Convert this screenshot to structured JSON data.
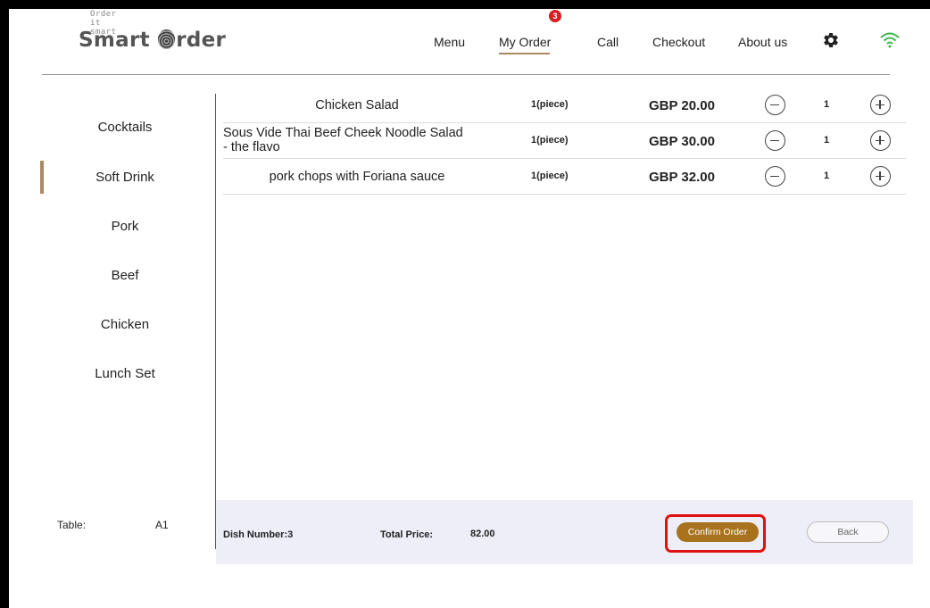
{
  "brand": {
    "tagline": "Order it smart",
    "name_prefix": "Smart",
    "name_suffix": "rder"
  },
  "nav": {
    "menu": "Menu",
    "my_order": "My Order",
    "order_badge": "3",
    "call": "Call",
    "checkout": "Checkout",
    "about": "About us",
    "settings_icon": "gear-icon",
    "wifi_icon": "wifi-icon"
  },
  "sidebar": {
    "items": [
      {
        "label": "Cocktails"
      },
      {
        "label": "Soft Drink",
        "active": true
      },
      {
        "label": "Pork"
      },
      {
        "label": "Beef"
      },
      {
        "label": "Chicken"
      },
      {
        "label": "Lunch Set"
      }
    ],
    "table_label": "Table:",
    "table_value": "A1"
  },
  "order": {
    "items": [
      {
        "name": "Chicken Salad",
        "unit": "1(piece)",
        "price": "GBP 20.00",
        "count": "1"
      },
      {
        "name_line1": "Sous Vide Thai Beef Cheek Noodle Salad",
        "name_line2": "- the flavo",
        "unit": "1(piece)",
        "price": "GBP 30.00",
        "count": "1"
      },
      {
        "name": "pork chops with Foriana sauce",
        "unit": "1(piece)",
        "price": "GBP 32.00",
        "count": "1"
      }
    ]
  },
  "footer": {
    "dish_number": "Dish Number:3",
    "total_label": "Total Price:",
    "total_value": "82.00",
    "confirm_label": "Confirm Order",
    "back_label": "Back"
  },
  "colors": {
    "accent": "#a98a5f",
    "confirm": "#a9721e",
    "badge": "#d42020",
    "wifi": "#39b54a",
    "highlight": "#e01010"
  }
}
